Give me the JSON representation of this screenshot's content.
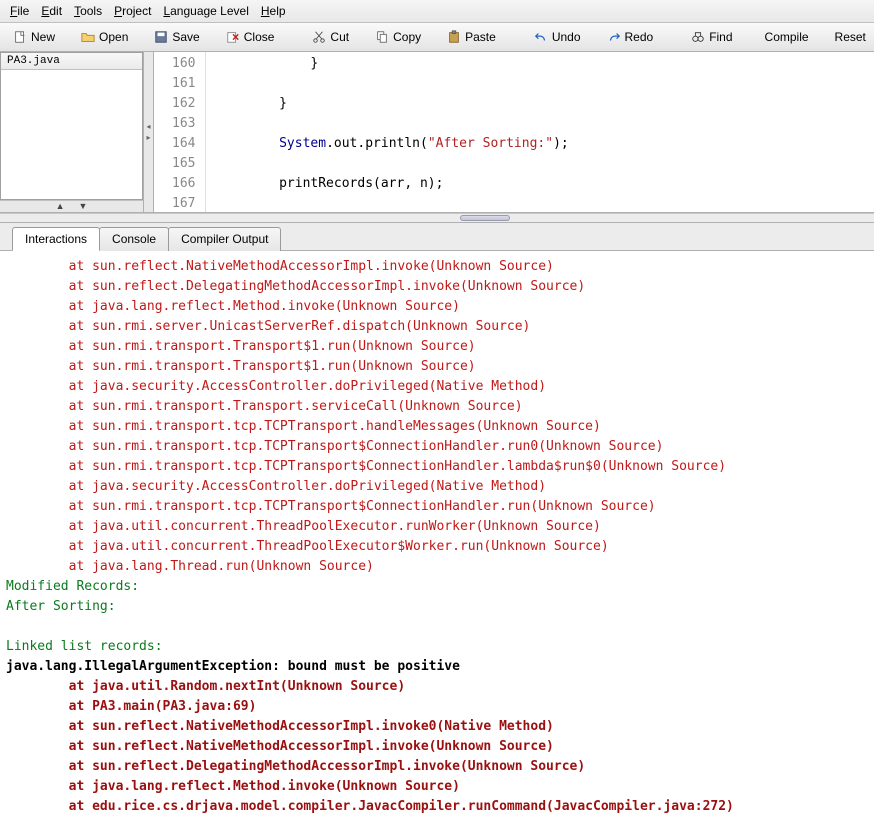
{
  "menu": {
    "file": "File",
    "edit": "Edit",
    "tools": "Tools",
    "project": "Project",
    "language": "Language Level",
    "help": "Help"
  },
  "toolbar": {
    "new": "New",
    "open": "Open",
    "save": "Save",
    "close": "Close",
    "cut": "Cut",
    "copy": "Copy",
    "paste": "Paste",
    "undo": "Undo",
    "redo": "Redo",
    "find": "Find",
    "compile": "Compile",
    "reset": "Reset"
  },
  "files": {
    "active": "PA3.java"
  },
  "editor": {
    "lines": [
      {
        "n": 160,
        "html": "            }"
      },
      {
        "n": 161,
        "html": ""
      },
      {
        "n": 162,
        "html": "        }"
      },
      {
        "n": 163,
        "html": ""
      },
      {
        "n": 164,
        "html": "        <span class=\"kw-type\">System</span>.out.println(<span class=\"str\">\"After Sorting:\"</span>);"
      },
      {
        "n": 165,
        "html": ""
      },
      {
        "n": 166,
        "html": "        printRecords(arr, n);"
      },
      {
        "n": 167,
        "html": ""
      }
    ]
  },
  "bottomTabs": {
    "interactions": "Interactions",
    "console": "Console",
    "compiler": "Compiler Output"
  },
  "console": [
    {
      "cls": "ln-red",
      "t": "        at sun.reflect.NativeMethodAccessorImpl.invoke(Unknown Source)"
    },
    {
      "cls": "ln-red",
      "t": "        at sun.reflect.DelegatingMethodAccessorImpl.invoke(Unknown Source)"
    },
    {
      "cls": "ln-red",
      "t": "        at java.lang.reflect.Method.invoke(Unknown Source)"
    },
    {
      "cls": "ln-red",
      "t": "        at sun.rmi.server.UnicastServerRef.dispatch(Unknown Source)"
    },
    {
      "cls": "ln-red",
      "t": "        at sun.rmi.transport.Transport$1.run(Unknown Source)"
    },
    {
      "cls": "ln-red",
      "t": "        at sun.rmi.transport.Transport$1.run(Unknown Source)"
    },
    {
      "cls": "ln-red",
      "t": "        at java.security.AccessController.doPrivileged(Native Method)"
    },
    {
      "cls": "ln-red",
      "t": "        at sun.rmi.transport.Transport.serviceCall(Unknown Source)"
    },
    {
      "cls": "ln-red",
      "t": "        at sun.rmi.transport.tcp.TCPTransport.handleMessages(Unknown Source)"
    },
    {
      "cls": "ln-red",
      "t": "        at sun.rmi.transport.tcp.TCPTransport$ConnectionHandler.run0(Unknown Source)"
    },
    {
      "cls": "ln-red",
      "t": "        at sun.rmi.transport.tcp.TCPTransport$ConnectionHandler.lambda$run$0(Unknown Source)"
    },
    {
      "cls": "ln-red",
      "t": "        at java.security.AccessController.doPrivileged(Native Method)"
    },
    {
      "cls": "ln-red",
      "t": "        at sun.rmi.transport.tcp.TCPTransport$ConnectionHandler.run(Unknown Source)"
    },
    {
      "cls": "ln-red",
      "t": "        at java.util.concurrent.ThreadPoolExecutor.runWorker(Unknown Source)"
    },
    {
      "cls": "ln-red",
      "t": "        at java.util.concurrent.ThreadPoolExecutor$Worker.run(Unknown Source)"
    },
    {
      "cls": "ln-red",
      "t": "        at java.lang.Thread.run(Unknown Source)"
    },
    {
      "cls": "ln-green",
      "t": "Modified Records:"
    },
    {
      "cls": "ln-green",
      "t": "After Sorting:"
    },
    {
      "cls": "ln-green",
      "t": ""
    },
    {
      "cls": "ln-green",
      "t": "Linked list records:"
    },
    {
      "cls": "ln-black",
      "t": "java.lang.IllegalArgumentException: bound must be positive"
    },
    {
      "cls": "ln-darkred",
      "t": "        at java.util.Random.nextInt(Unknown Source)"
    },
    {
      "cls": "ln-darkred",
      "t": "        at PA3.main(PA3.java:69)"
    },
    {
      "cls": "ln-darkred",
      "t": "        at sun.reflect.NativeMethodAccessorImpl.invoke0(Native Method)"
    },
    {
      "cls": "ln-darkred",
      "t": "        at sun.reflect.NativeMethodAccessorImpl.invoke(Unknown Source)"
    },
    {
      "cls": "ln-darkred",
      "t": "        at sun.reflect.DelegatingMethodAccessorImpl.invoke(Unknown Source)"
    },
    {
      "cls": "ln-darkred",
      "t": "        at java.lang.reflect.Method.invoke(Unknown Source)"
    },
    {
      "cls": "ln-darkred",
      "t": "        at edu.rice.cs.drjava.model.compiler.JavacCompiler.runCommand(JavacCompiler.java:272)"
    }
  ]
}
